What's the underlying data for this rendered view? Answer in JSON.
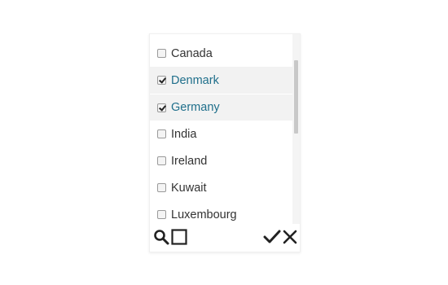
{
  "country_list": {
    "items": [
      {
        "label": "Canada",
        "checked": false
      },
      {
        "label": "Denmark",
        "checked": true
      },
      {
        "label": "Germany",
        "checked": true
      },
      {
        "label": "India",
        "checked": false
      },
      {
        "label": "Ireland",
        "checked": false
      },
      {
        "label": "Kuwait",
        "checked": false
      },
      {
        "label": "Luxembourg",
        "checked": false
      }
    ]
  },
  "toolbar": {
    "icons": [
      "search-icon",
      "select-all-icon",
      "confirm-icon",
      "cancel-icon"
    ]
  },
  "colors": {
    "selected_text": "#1f6f8b",
    "selected_background": "#f2f2f2",
    "text": "#333333"
  }
}
